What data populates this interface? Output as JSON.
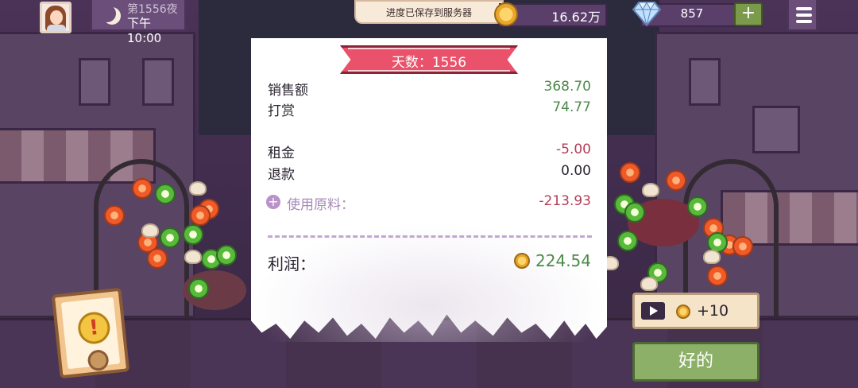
{
  "hud": {
    "night": "第1556夜",
    "time": "下午10:00",
    "toast": "进度已保存到服务器",
    "coins": "16.62万",
    "gems": "857",
    "add_symbol": "+"
  },
  "receipt": {
    "banner": "天数：1556",
    "sales_label": "销售额",
    "sales_value": "368.70",
    "tips_label": "打赏",
    "tips_value": "74.77",
    "rent_label": "租金",
    "rent_value": "-5.00",
    "refund_label": "退款",
    "refund_value": "0.00",
    "ingredients_label": "使用原料：",
    "ingredients_value": "-213.93",
    "profit_label": "利润：",
    "profit_value": "224.54"
  },
  "actions": {
    "ad_reward": "+10",
    "ok_label": "好的"
  },
  "colors": {
    "positive": "#4d8a4a",
    "negative": "#b33d5a",
    "banner": "#e9526a",
    "ok_button": "#8cb068"
  },
  "icons": [
    "moon-icon",
    "coin-icon",
    "diamond-icon",
    "plus-icon",
    "menu-icon",
    "play-icon",
    "alert-icon"
  ]
}
